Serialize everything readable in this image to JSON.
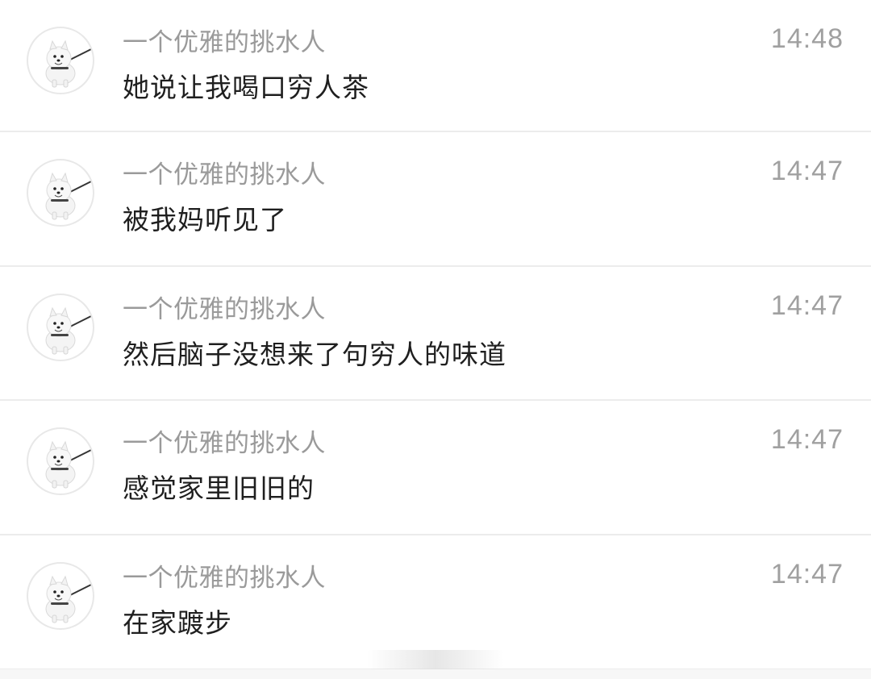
{
  "messages": [
    {
      "sender": "一个优雅的挑水人",
      "time": "14:48",
      "text": "她说让我喝口穷人茶",
      "avatar_icon": "samoyed-dog-avatar-icon"
    },
    {
      "sender": "一个优雅的挑水人",
      "time": "14:47",
      "text": "被我妈听见了",
      "avatar_icon": "samoyed-dog-avatar-icon"
    },
    {
      "sender": "一个优雅的挑水人",
      "time": "14:47",
      "text": "然后脑子没想来了句穷人的味道",
      "avatar_icon": "samoyed-dog-avatar-icon"
    },
    {
      "sender": "一个优雅的挑水人",
      "time": "14:47",
      "text": "感觉家里旧旧的",
      "avatar_icon": "samoyed-dog-avatar-icon"
    },
    {
      "sender": "一个优雅的挑水人",
      "time": "14:47",
      "text": "在家踱步",
      "avatar_icon": "samoyed-dog-avatar-icon"
    }
  ],
  "colors": {
    "sender": "#9a9a9a",
    "time": "#a0a0a0",
    "text": "#1f1f1f",
    "divider": "#ececec",
    "background": "#ffffff"
  }
}
